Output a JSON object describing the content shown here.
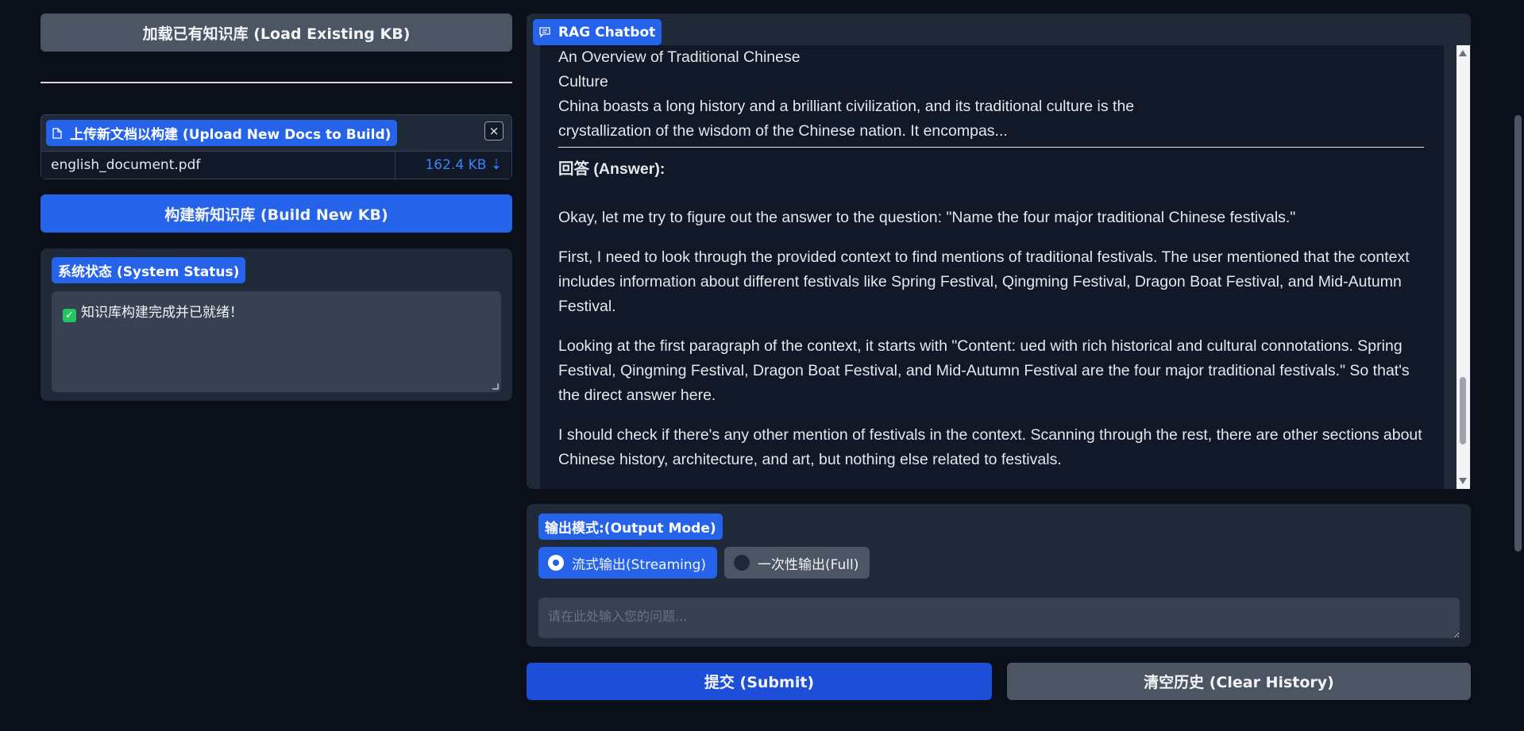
{
  "left": {
    "load_button": "加载已有知识库 (Load Existing KB)",
    "upload_label": "上传新文档以构建 (Upload New Docs to Build)",
    "close_glyph": "×",
    "file": {
      "name": "english_document.pdf",
      "size": "162.4 KB ⇣"
    },
    "build_button": "构建新知识库 (Build New KB)",
    "status_label": "系统状态 (System Status)",
    "status_text": "知识库构建完成并已就绪！"
  },
  "chat": {
    "label": "RAG Chatbot",
    "context_lines": [
      "An Overview of Traditional Chinese",
      "Culture",
      "China boasts a long history and a brilliant civilization, and its traditional culture is the",
      "crystallization of the wisdom of the Chinese nation. It encompas..."
    ],
    "answer_label": "回答 (Answer):",
    "paragraphs": [
      "Okay, let me try to figure out the answer to the question: \"Name the four major traditional Chinese festivals.\"",
      "First, I need to look through the provided context to find mentions of traditional festivals. The user mentioned that the context includes information about different festivals like Spring Festival, Qingming Festival, Dragon Boat Festival, and Mid-Autumn Festival.",
      "Looking at the first paragraph of the context, it starts with \"Content: ued with rich historical and cultural connotations. Spring Festival, Qingming Festival, Dragon Boat Festival, and Mid-Autumn Festival are the four major traditional festivals.\" So that's the direct answer here.",
      "I should check if there's any other mention of festivals in the context. Scanning through the rest, there are other sections about Chinese history, architecture, and art, but nothing else related to festivals."
    ]
  },
  "mode": {
    "label": "输出模式:(Output Mode)",
    "options": [
      "流式输出(Streaming)",
      "一次性输出(Full)"
    ],
    "selected": "流式输出(Streaming)",
    "input_placeholder": "请在此处输入您的问题...",
    "input_value": ""
  },
  "actions": {
    "submit": "提交 (Submit)",
    "clear": "清空历史 (Clear History)"
  },
  "colors": {
    "background": "#0b0f19",
    "panel": "#1f2937",
    "primary": "#1d4ed8",
    "secondary": "#4b5563",
    "accent": "#2563eb"
  },
  "icons": {
    "upload": "file-icon",
    "chat": "chat-icon",
    "close": "close-icon",
    "status": "check-icon"
  }
}
